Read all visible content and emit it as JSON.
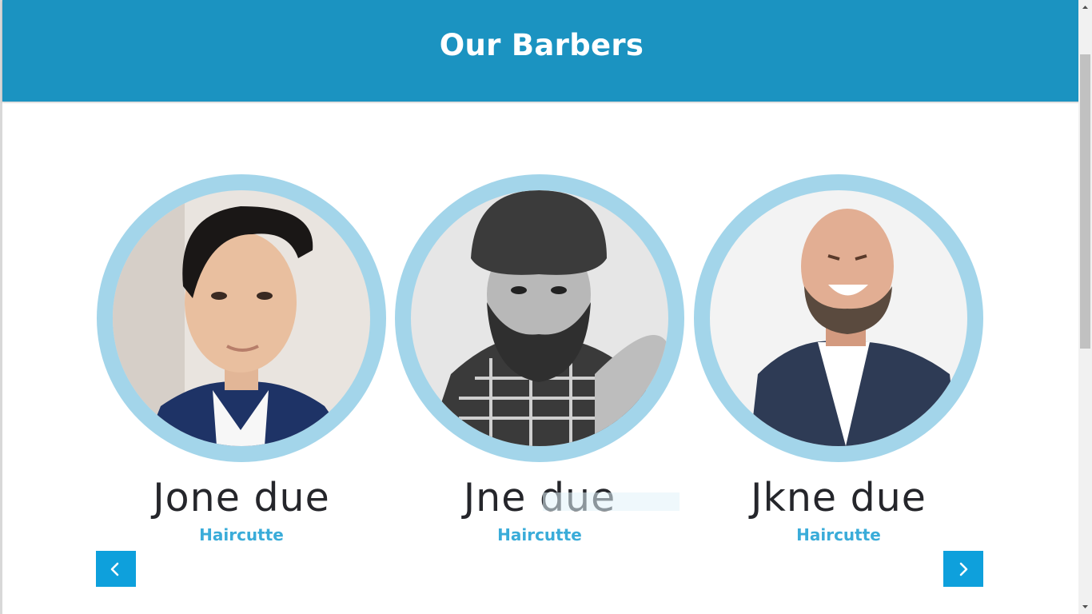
{
  "header": {
    "title": "Our Barbers",
    "background_color": "#1b93c1"
  },
  "barbers": [
    {
      "name": "Jone due",
      "role": "Haircutte",
      "photo_icon": "barber-photo-young-man-suit"
    },
    {
      "name": "Jne due",
      "role": "Haircutte",
      "photo_icon": "barber-photo-bearded-beanie"
    },
    {
      "name": "Jkne due",
      "role": "Haircutte",
      "photo_icon": "barber-photo-bald-laughing"
    }
  ],
  "carousel": {
    "prev_icon": "chevron-left-icon",
    "next_icon": "chevron-right-icon",
    "button_color": "#0ea0dc"
  },
  "colors": {
    "ring": "#a3d5ea",
    "name_text": "#25262b",
    "role_text": "#3aacd9"
  }
}
